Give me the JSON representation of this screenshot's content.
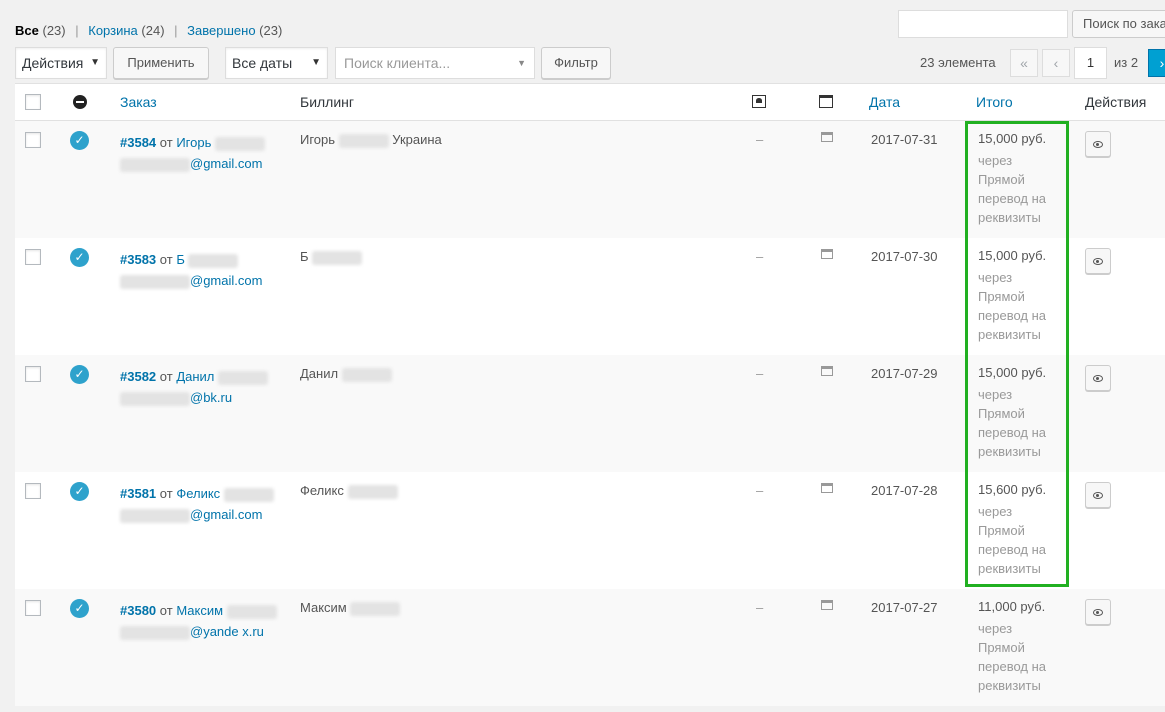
{
  "views": {
    "all_label": "Все",
    "all_count": "(23)",
    "cart_label": "Корзина",
    "cart_count": "(24)",
    "done_label": "Завершено",
    "done_count": "(23)",
    "separator": "|"
  },
  "search": {
    "button_label": "Поиск по заказам",
    "value": ""
  },
  "toolbar": {
    "bulk_action": "Действия",
    "apply_label": "Применить",
    "dates": "Все даты",
    "customer_placeholder": "Поиск клиента...",
    "filter_label": "Фильтр"
  },
  "pagination": {
    "items_count": "23 элемента",
    "first": "«",
    "prev": "‹",
    "current_page": "1",
    "of_total": "из 2",
    "next": "›"
  },
  "columns": {
    "order": "Заказ",
    "billing": "Биллинг",
    "date": "Дата",
    "total": "Итого",
    "actions": "Действия"
  },
  "orders": [
    {
      "number": "#3584",
      "from": "от",
      "name": "Игорь",
      "email": "@gmail.com",
      "billing_name": "Игорь",
      "billing_country": "Украина",
      "shipping": "–",
      "date": "2017-07-31",
      "amount": "15,000 руб.",
      "method": "через Прямой перевод на реквизиты"
    },
    {
      "number": "#3583",
      "from": "от",
      "name": "Б",
      "email": "@gmail.com",
      "billing_name": "Б",
      "billing_country": "",
      "shipping": "–",
      "date": "2017-07-30",
      "amount": "15,000 руб.",
      "method": "через Прямой перевод на реквизиты"
    },
    {
      "number": "#3582",
      "from": "от",
      "name": "Данил",
      "email": "@bk.ru",
      "billing_name": "Данил",
      "billing_country": "",
      "shipping": "–",
      "date": "2017-07-29",
      "amount": "15,000 руб.",
      "method": "через Прямой перевод на реквизиты"
    },
    {
      "number": "#3581",
      "from": "от",
      "name": "Феликс",
      "email": "@gmail.com",
      "billing_name": "Феликс",
      "billing_country": "",
      "shipping": "–",
      "date": "2017-07-28",
      "amount": "15,600 руб.",
      "method": "через Прямой перевод на реквизиты"
    },
    {
      "number": "#3580",
      "from": "от",
      "name": "Максим",
      "email": "@yande x.ru",
      "billing_name": "Максим",
      "billing_country": "",
      "shipping": "–",
      "date": "2017-07-27",
      "amount": "11,000 руб.",
      "method": "через Прямой перевод на реквизиты"
    }
  ],
  "colors": {
    "highlight": "#21b021",
    "link": "#0073aa",
    "status": "#2ea2cc"
  }
}
